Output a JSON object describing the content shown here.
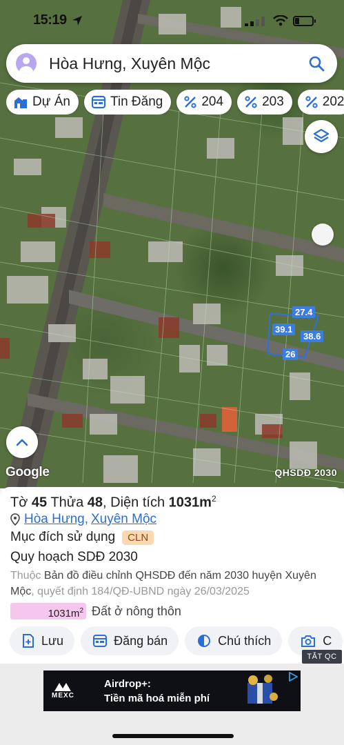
{
  "status_bar": {
    "time": "15:19"
  },
  "search": {
    "query": "Hòa Hưng, Xuyên Mộc"
  },
  "chips": [
    {
      "label": "Dự Án",
      "icon": "project-icon"
    },
    {
      "label": "Tin Đăng",
      "icon": "listing-icon"
    },
    {
      "label": "204",
      "icon": "parcel-icon"
    },
    {
      "label": "203",
      "icon": "parcel-icon"
    },
    {
      "label": "202",
      "icon": "parcel-icon"
    }
  ],
  "map": {
    "attribution": "Google",
    "layer_label": "QHSDĐ 2030",
    "dimensions": [
      "27.4",
      "39.1",
      "38.6",
      "26"
    ]
  },
  "parcel": {
    "sheet_label": "Tờ",
    "sheet_no": "45",
    "plot_label": "Thửa",
    "plot_no": "48",
    "area_label": "Diện tích",
    "area_value": "1031m",
    "area_unit_sup": "2",
    "commune": "Hòa Hưng",
    "district": "Xuyên Mộc",
    "purpose_label": "Mục đích sử dụng",
    "purpose_code": "CLN",
    "plan_title": "Quy hoạch SDĐ 2030",
    "belongs_prefix": "Thuộc",
    "belongs_map": "Bản đồ điều chỉnh QHSDĐ đến năm 2030 huyện Xuyên Mộc",
    "belongs_decision": ", quyết định 184/QĐ-UBND ngày 26/03/2025",
    "area_bar_value": "1031m",
    "area_bar_sup": "2",
    "area_bar_label": "Đất ở nông thôn",
    "area_bar_fraction": 1.0
  },
  "actions": [
    {
      "label": "Lưu",
      "icon": "save-icon"
    },
    {
      "label": "Đăng bán",
      "icon": "post-sale-icon"
    },
    {
      "label": "Chú thích",
      "icon": "legend-icon"
    },
    {
      "label": "C",
      "icon": "camera-icon"
    }
  ],
  "ad": {
    "close_label": "TẮT QC",
    "brand": "MEXC",
    "headline": "Airdrop+:",
    "subline": "Tiền mã hoá miễn phí"
  },
  "colors": {
    "link": "#2b6fd6",
    "cln_badge_bg": "#fcd8b0",
    "area_bar": "#f7c6ef",
    "dimension_label_bg": "#3b7de0",
    "parcel_outline": "#2f6fe0"
  }
}
